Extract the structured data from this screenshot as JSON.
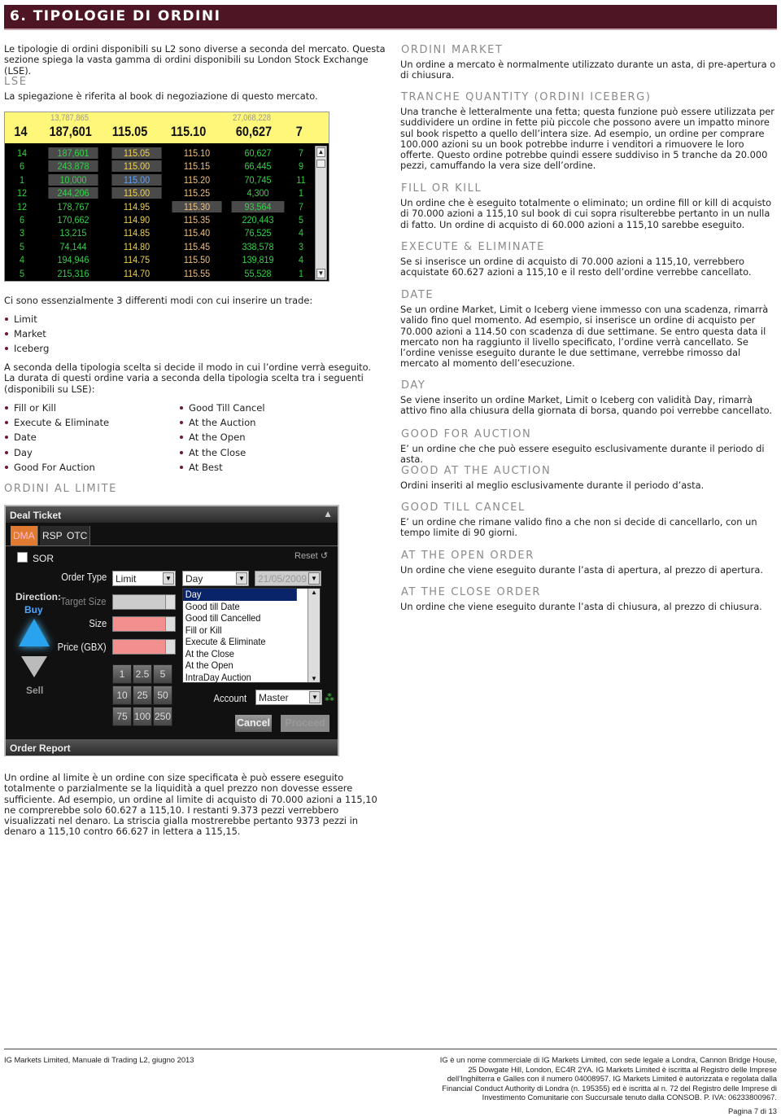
{
  "header": {
    "title": "6. TIPOLOGIE DI ORDINI",
    "color": "#4e1624"
  },
  "left": {
    "intro": "Le tipologie di ordini disponibili su L2 sono diverse a seconda del mercato. Questa sezione spiega la vasta gamma di ordini disponibili su London Stock Exchange (LSE).",
    "lse_heading": "LSE",
    "lse_text": "La spiegazione è riferita al book di negoziazione di questo mercato.",
    "modes_intro": "Ci sono essenzialmente 3 differenti modi con cui inserire un trade:",
    "modes": [
      "Limit",
      "Market",
      "Iceberg"
    ],
    "duration_text": "A seconda della tipologia scelta si decide il modo in cui l’ordine verrà eseguito. La durata di questi ordine varia a seconda della tipologia scelta tra i seguenti (disponibili su LSE):",
    "durations_col1": [
      "Fill or Kill",
      "Execute & Eliminate",
      "Date",
      "Day",
      "Good For Auction"
    ],
    "durations_col2": [
      "Good Till Cancel",
      "At the Auction",
      "At the Open",
      "At the Close",
      "At Best"
    ],
    "limit_heading": "ORDINI AL LIMITE",
    "limit_text": "Un ordine al limite è un ordine con size specificata è può essere eseguito totalmente o parzialmente se la liquidità a quel prezzo non dovesse essere sufficiente. Ad esempio, un ordine al limite di acquisto di 70.000 azioni a 115,10 ne comprerebbe solo 60.627 a 115,10. I restanti 9.373 pezzi verrebbero visualizzati nel denaro. La striscia gialla mostrerebbe pertanto 9373 pezzi in denaro a 115,10 contro 66.627 in lettera a 115,15."
  },
  "order_book": {
    "summary": {
      "bid_count": "14",
      "bid_total": "13,787,865",
      "bid_volume": "187,601",
      "bid_price": "115.05",
      "ask_price": "115.10",
      "ask_volume": "60,627",
      "ask_total": "27,068,228",
      "ask_count": "7"
    },
    "rows": [
      [
        "14",
        "187,601",
        "115.05",
        "115.10",
        "60,627",
        "7"
      ],
      [
        "6",
        "243,878",
        "115.00",
        "115.15",
        "66,445",
        "9"
      ],
      [
        "1",
        "10,000",
        "115.00",
        "115.20",
        "70,745",
        "11"
      ],
      [
        "12",
        "244,206",
        "115.00",
        "115.25",
        "4,300",
        "1"
      ],
      [
        "12",
        "178,767",
        "114.95",
        "115.30",
        "93,564",
        "7"
      ],
      [
        "6",
        "170,662",
        "114.90",
        "115.35",
        "220,443",
        "5"
      ],
      [
        "3",
        "13,215",
        "114.85",
        "115.40",
        "76,525",
        "4"
      ],
      [
        "5",
        "74,144",
        "114.80",
        "115.45",
        "338,578",
        "3"
      ],
      [
        "4",
        "194,946",
        "114.75",
        "115.50",
        "139,819",
        "4"
      ],
      [
        "5",
        "215,316",
        "114.70",
        "115.55",
        "55,528",
        "1"
      ]
    ]
  },
  "deal_ticket": {
    "title": "Deal Ticket",
    "tabs": [
      "DMA",
      "RSP",
      "OTC"
    ],
    "active_tab": "DMA",
    "sor_label": "SOR",
    "reset_label": "Reset",
    "order_type_label": "Order Type",
    "order_type_value": "Limit",
    "validity_value": "Day",
    "date_value": "21/05/2009",
    "direction_label": "Direction:",
    "direction_value": "Buy",
    "sell_label": "Sell",
    "target_size_label": "Target Size",
    "size_label": "Size",
    "price_label": "Price (GBX)",
    "validity_options": [
      "Day",
      "Good till Date",
      "Good till Cancelled",
      "Fill or Kill",
      "Execute & Eliminate",
      "At the Close",
      "At the Open",
      "IntraDay Auction"
    ],
    "quick_sizes": [
      "1",
      "2.5",
      "5",
      "10",
      "25",
      "50",
      "75",
      "100",
      "250"
    ],
    "account_label": "Account",
    "account_value": "Master",
    "cancel_label": "Cancel",
    "proceed_label": "Proceed",
    "order_report_label": "Order Report"
  },
  "right": [
    {
      "heading": "ORDINI MARKET",
      "text": "Un ordine a mercato è normalmente utilizzato durante un asta, di pre-apertura o di chiusura."
    },
    {
      "heading": "TRANCHE QUANTITY (ORDINI ICEBERG)",
      "text": "Una tranche è letteralmente una fetta; questa funzione può essere utilizzata per suddividere un ordine in fette più piccole che possono avere un impatto minore sul book rispetto a quello dell’intera size. Ad esempio, un ordine per comprare 100.000 azioni su un book potrebbe indurre i venditori a rimuovere le loro offerte. Questo ordine potrebbe quindi essere suddiviso in 5 tranche da 20.000 pezzi, camuffando la vera size dell’ordine."
    },
    {
      "heading": "FILL OR KILL",
      "text": "Un ordine che è eseguito totalmente o eliminato; un ordine fill or kill di acquisto di 70.000 azioni a 115,10 sul book di cui sopra risulterebbe pertanto in un nulla di fatto. Un ordine di acquisto di 60.000 azioni a 115,10 sarebbe eseguito."
    },
    {
      "heading": "EXECUTE & ELIMINATE",
      "text": "Se si inserisce un ordine di acquisto di 70.000 azioni a 115,10, verrebbero acquistate 60.627 azioni a 115,10 e il resto dell’ordine verrebbe cancellato."
    },
    {
      "heading": "DATE",
      "text": "Se un ordine Market, Limit o Iceberg viene immesso con una scadenza, rimarrà valido fino quel momento. Ad esempio, si inserisce un ordine di acquisto per 70.000 azioni a 114.50 con scadenza di due settimane. Se entro questa data il mercato non ha raggiunto il livello specificato, l’ordine verrà cancellato. Se l’ordine venisse eseguito durante le due settimane, verrebbe rimosso dal mercato al momento dell’esecuzione."
    },
    {
      "heading": "DAY",
      "text": "Se viene inserito un ordine Market, Limit o Iceberg con validità Day, rimarrà attivo fino alla chiusura della giornata di borsa, quando poi verrebbe cancellato."
    },
    {
      "heading": "GOOD FOR AUCTION",
      "text": "E’ un ordine che che può essere eseguito esclusivamente durante il periodo di asta."
    },
    {
      "heading": "GOOD AT THE AUCTION",
      "text": "Ordini inseriti al meglio esclusivamente durante il periodo d’asta."
    },
    {
      "heading": "GOOD TILL CANCEL",
      "text": "E’ un ordine che rimane valido fino a che non si decide di cancellarlo, con un tempo limite di 90 giorni."
    },
    {
      "heading": "AT THE OPEN ORDER",
      "text": "Un ordine che viene eseguito durante l’asta di apertura, al prezzo di apertura."
    },
    {
      "heading": "AT THE CLOSE ORDER",
      "text": "Un ordine che viene eseguito durante l’asta di chiusura, al prezzo di chiusura."
    }
  ],
  "footer": {
    "left": "IG Markets Limited, Manuale di Trading L2, giugno 2013",
    "right": "IG è un nome commerciale di IG Markets Limited, con sede legale a Londra, Cannon Bridge House, 25 Dowgate Hill, London, EC4R 2YA. IG Markets Limited è iscritta al Registro delle Imprese dell’Inghilterra e Galles con il numero 04008957. IG Markets Limited è autorizzata e regolata dalla Financial Conduct Authority di Londra (n. 195355) ed è iscritta al n. 72 del Registro delle Imprese di Investimento Comunitarie con Succursale tenuto dalla CONSOB. P. IVA: 06233800967.",
    "page": "Pagina 7 di 13"
  }
}
